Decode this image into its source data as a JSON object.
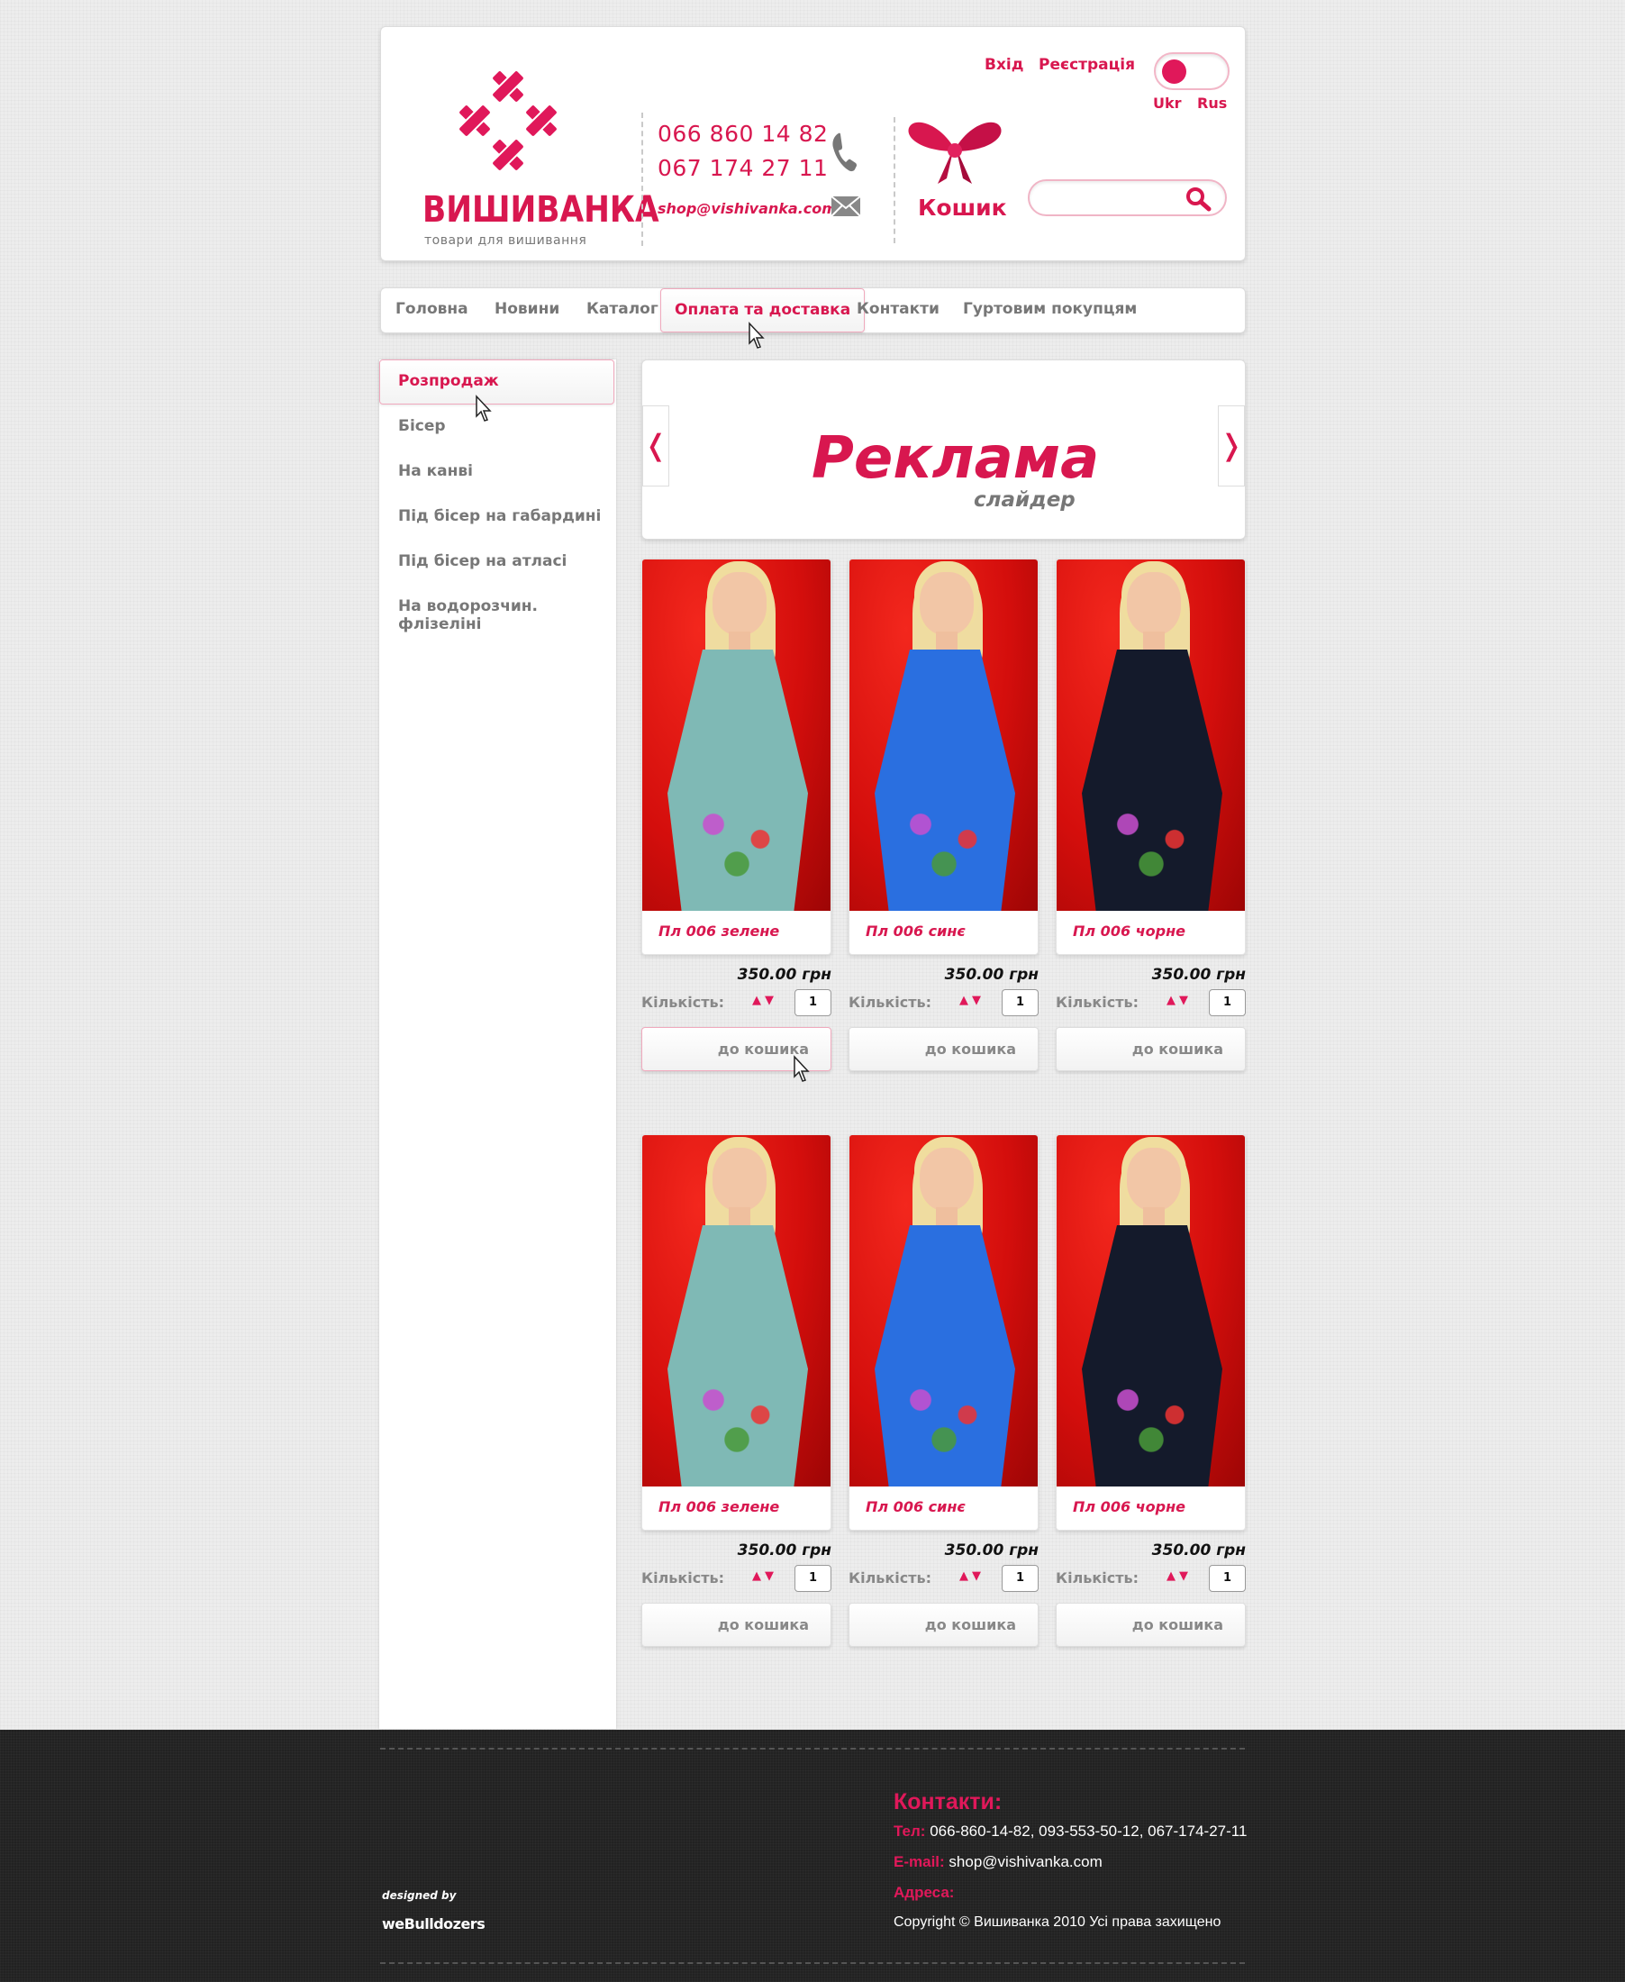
{
  "header": {
    "logo_title": "ВИШИВАНКА",
    "logo_subtitle": "товари для вишивання",
    "phone1": "066 860 14 82",
    "phone2": "067 174 27 11",
    "email": "shop@vishivanka.com",
    "cart_label": "Кошик",
    "login": "Вхід",
    "register": "Реєстрація",
    "lang_ukr": "Ukr",
    "lang_rus": "Rus",
    "search_placeholder": ""
  },
  "menu": [
    "Головна",
    "Новини",
    "Каталог",
    "Оплата та доставка",
    "Контакти",
    "Гуртовим покупцям"
  ],
  "sidebar": [
    "Розпродаж",
    "Бісер",
    "На канві",
    "Під бісер на габардині",
    "Під бісер на атласі",
    "На водорозчин. флізеліні"
  ],
  "slider": {
    "title": "Реклама",
    "subtitle": "слайдер",
    "prev": "❬",
    "next": "❭"
  },
  "product_common": {
    "qty_label": "Кількість:",
    "qty_value": "1",
    "add_label": "до кошика"
  },
  "products": [
    {
      "name": "Пл 006 зелене",
      "price": "350.00 грн",
      "dress_color": "#7fb9b5"
    },
    {
      "name": "Пл 006 синє",
      "price": "350.00 грн",
      "dress_color": "#2a6fe0"
    },
    {
      "name": "Пл 006 чорне",
      "price": "350.00 грн",
      "dress_color": "#141a2b"
    },
    {
      "name": "Пл 006 зелене",
      "price": "350.00 грн",
      "dress_color": "#7fb9b5"
    },
    {
      "name": "Пл 006 синє",
      "price": "350.00 грн",
      "dress_color": "#2a6fe0"
    },
    {
      "name": "Пл 006 чорне",
      "price": "350.00 грн",
      "dress_color": "#141a2b"
    }
  ],
  "footer": {
    "heading": "Контакти:",
    "tel_label": "Тел:",
    "tel_value": "066-860-14-82, 093-553-50-12, 067-174-27-11",
    "email_label": "E-mail:",
    "email_value": "shop@vishivanka.com",
    "address_label": "Адреса:",
    "copyright": "Copyright © Вишиванка 2010  Усі права захищено",
    "designed_by": "designed by",
    "designer": "weBulldozers"
  },
  "colors": {
    "accent": "#e0185a",
    "footer_bg": "#222222"
  }
}
